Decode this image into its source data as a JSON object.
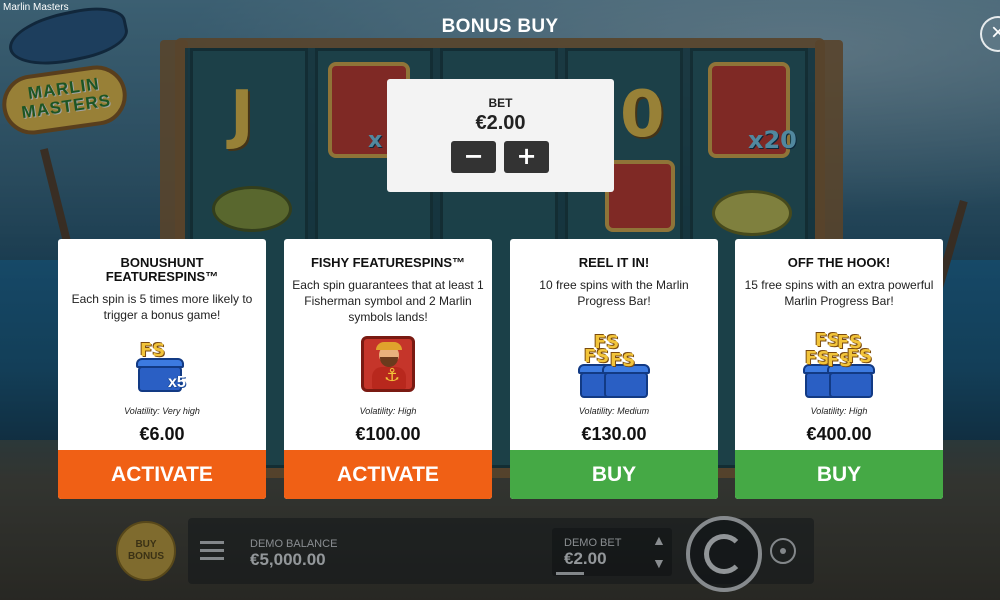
{
  "window_title": "Marlin Masters",
  "logo": {
    "line1": "MARLIN",
    "line2": "MASTERS"
  },
  "modal": {
    "title": "BONUS BUY",
    "close_icon": "close-icon",
    "bet": {
      "label": "BET",
      "value": "€2.00",
      "decrease_symbol": "−",
      "increase_symbol": "+"
    },
    "cards": [
      {
        "title": "BONUSHUNT FEATURESPINS™",
        "description": "Each spin is 5 times more likely to trigger a bonus game!",
        "icon": "fs-chest-x5-icon",
        "volatility": "Volatility: Very high",
        "price": "€6.00",
        "button": "ACTIVATE",
        "button_color": "#f06015"
      },
      {
        "title": "FISHY FEATURESPINS™",
        "description": "Each spin guarantees that at least 1 Fisherman symbol and 2 Marlin symbols lands!",
        "icon": "fisherman-icon",
        "volatility": "Volatility: High",
        "price": "€100.00",
        "button": "ACTIVATE",
        "button_color": "#f06015"
      },
      {
        "title": "REEL IT IN!",
        "description": "10 free spins with the Marlin Progress Bar!",
        "icon": "fs-chests-stack-icon",
        "volatility": "Volatility: Medium",
        "price": "€130.00",
        "button": "BUY",
        "button_color": "#45a945"
      },
      {
        "title": "OFF THE HOOK!",
        "description": "15 free spins with an extra powerful Marlin Progress Bar!",
        "icon": "fs-chests-big-stack-icon",
        "volatility": "Volatility: High",
        "price": "€400.00",
        "button": "BUY",
        "button_color": "#45a945"
      }
    ]
  },
  "controls": {
    "buy_bonus_line1": "BUY",
    "buy_bonus_line2": "BONUS",
    "demo_balance_label": "DEMO BALANCE",
    "demo_balance_value": "€5,000.00",
    "demo_bet_label": "DEMO BET",
    "demo_bet_value": "€2.00"
  },
  "icons": {
    "menu": "menu-icon",
    "spin": "spin-icon",
    "autoplay": "autoplay-icon",
    "bet_up": "chevron-up-icon",
    "bet_down": "chevron-down-icon"
  }
}
